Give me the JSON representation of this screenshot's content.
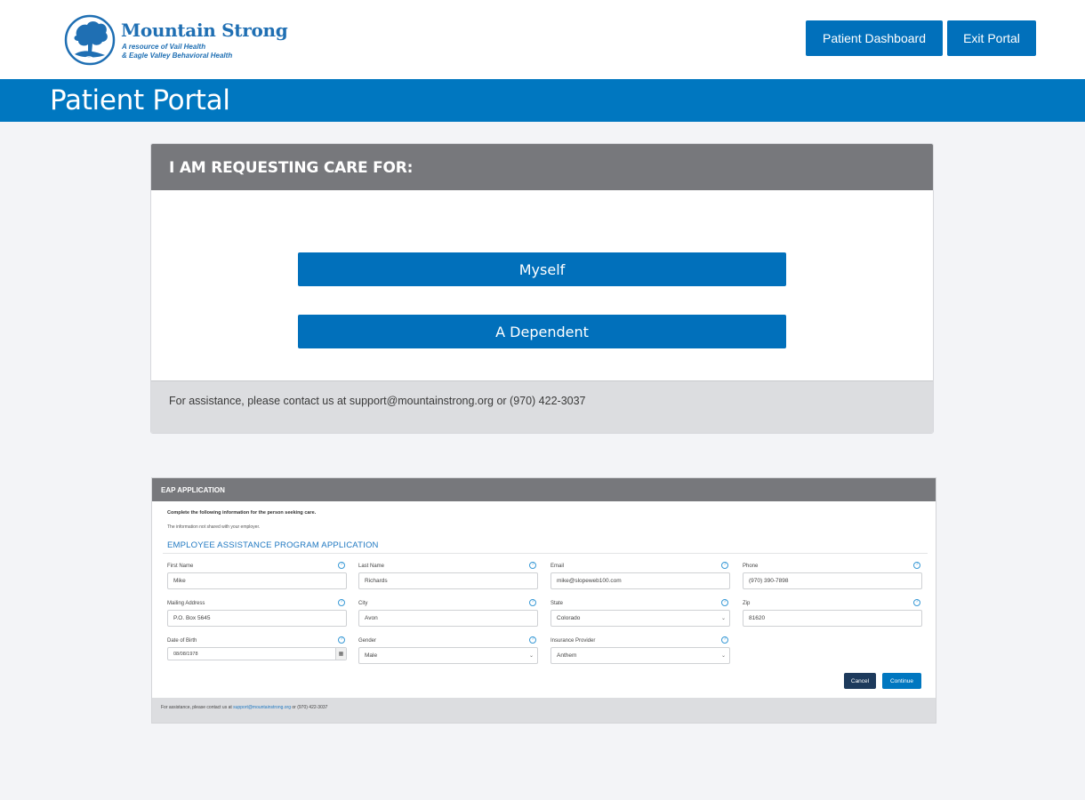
{
  "brand": {
    "title": "Mountain Strong",
    "subtitle_line1": "A resource of Vail Health",
    "subtitle_line2": "& Eagle Valley Behavioral Health",
    "color": "#1f6fb3",
    "icon": "tree-logo-icon"
  },
  "header": {
    "dashboard_label": "Patient Dashboard",
    "exit_label": "Exit Portal"
  },
  "banner": {
    "title": "Patient Portal"
  },
  "care_card": {
    "title": "I AM REQUESTING CARE FOR:",
    "options": [
      "Myself",
      "A Dependent"
    ],
    "footer": "For assistance, please contact us at support@mountainstrong.org or (970) 422-3037"
  },
  "eap": {
    "title": "EAP APPLICATION",
    "intro1": "Complete the following information for the person seeking care.",
    "intro2": "The information not shared with your employer.",
    "section": "EMPLOYEE ASSISTANCE PROGRAM APPLICATION",
    "fields": [
      {
        "label": "First Name",
        "value": "Mike"
      },
      {
        "label": "Last Name",
        "value": "Richards"
      },
      {
        "label": "Email",
        "value": "mike@slopeweb100.com"
      },
      {
        "label": "Phone",
        "value": "(970) 390-7898"
      },
      {
        "label": "Mailing Address",
        "value": "P.O. Box 5645"
      },
      {
        "label": "City",
        "value": "Avon"
      },
      {
        "label": "State",
        "value": "Colorado"
      },
      {
        "label": "Zip",
        "value": "81620"
      },
      {
        "label": "Date of Birth",
        "value": "08/08/1978"
      },
      {
        "label": "Gender",
        "value": "Male"
      },
      {
        "label": "Insurance Provider",
        "value": "Anthem"
      }
    ],
    "cancel_label": "Cancel",
    "continue_label": "Continue",
    "footer_prefix": "For assistance, please contact us at",
    "footer_email": "support@mountainstrong.org",
    "footer_suffix": "or (970) 422-3037"
  },
  "colors": {
    "primary": "#0170bb",
    "banner": "#0077c0",
    "card_header": "#77787c",
    "footer_gray": "#dcdde0",
    "page_bg": "#f3f4f7"
  }
}
